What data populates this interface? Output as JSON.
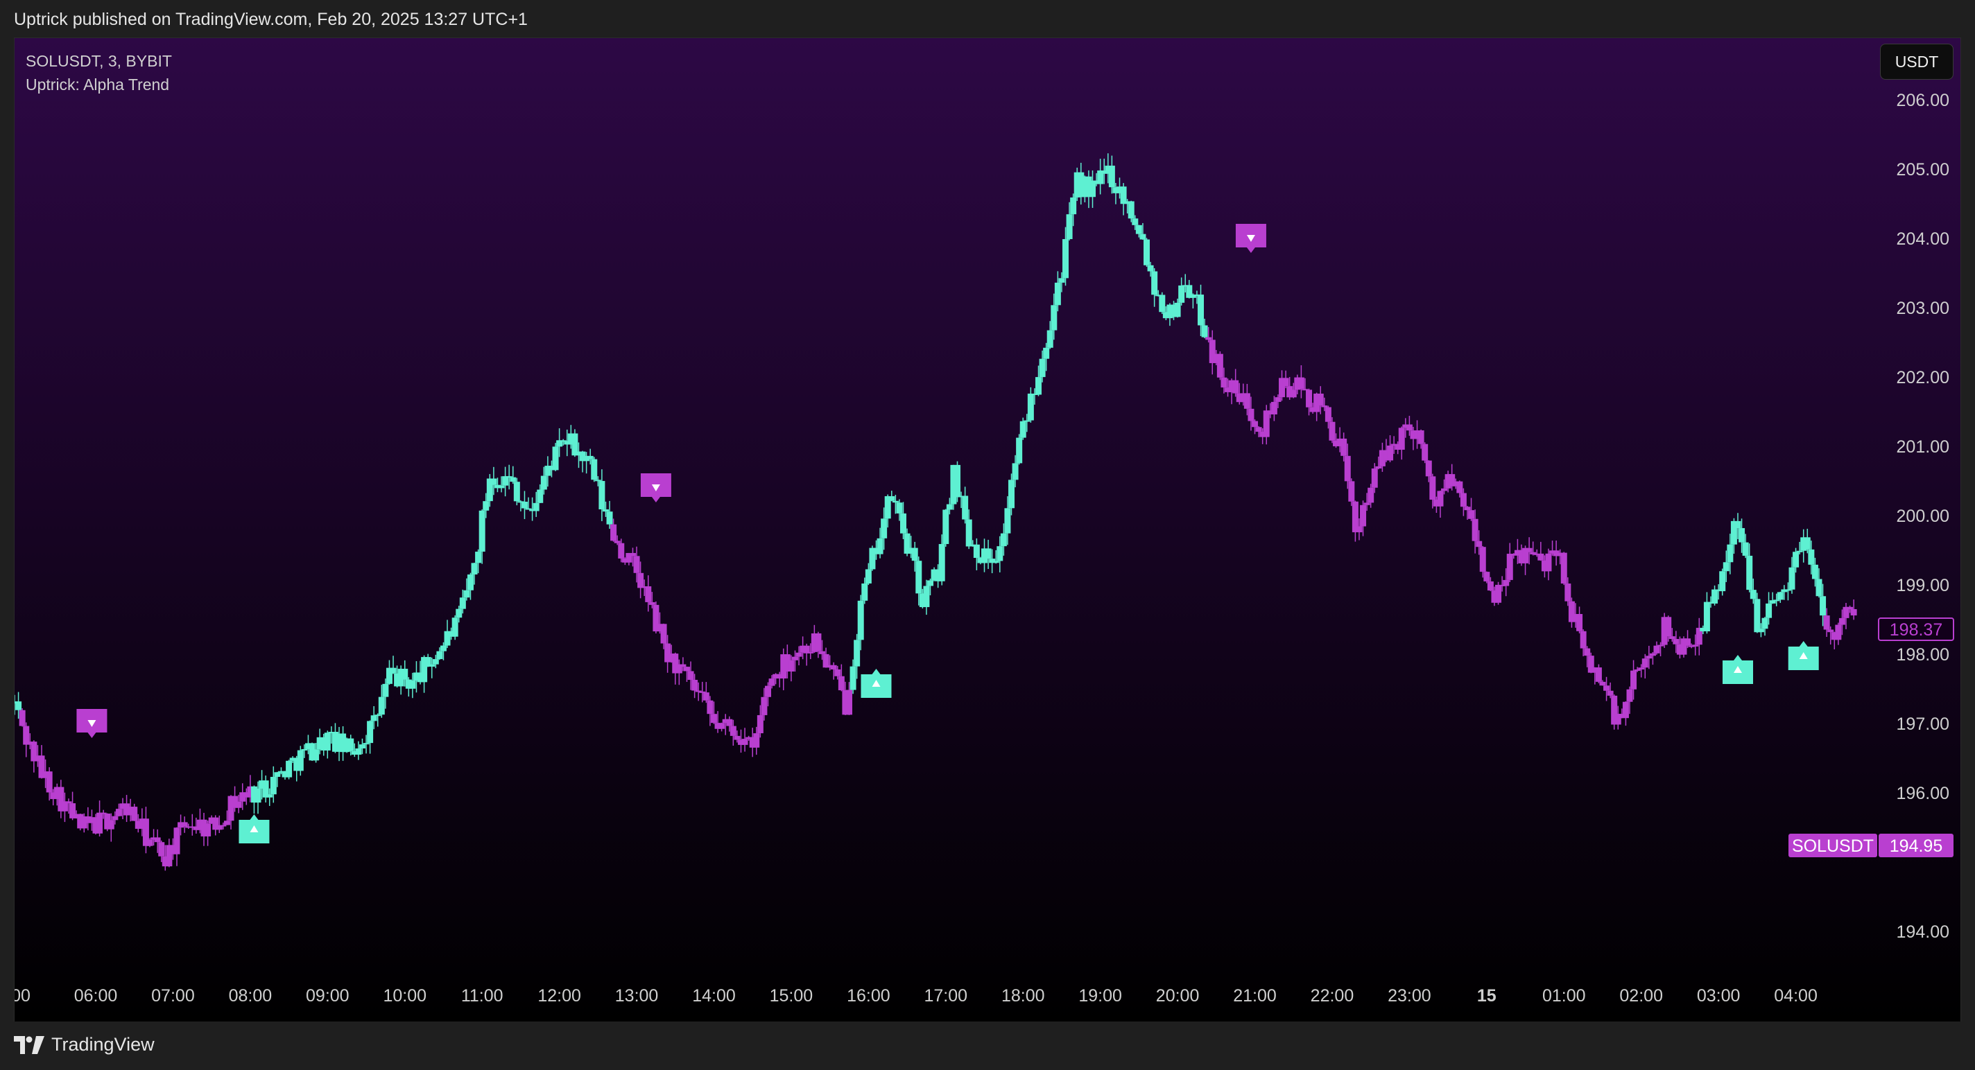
{
  "header": {
    "published_text": "Uptrick published on TradingView.com, Feb 20, 2025 13:27 UTC+1"
  },
  "legend": {
    "symbol_line": "SOLUSDT, 3, BYBIT",
    "indicator_line": "Uptrick: Alpha Trend"
  },
  "toolbar": {
    "currency_label": "USDT"
  },
  "footer": {
    "brand": "TradingView"
  },
  "colors": {
    "bull": "#5ef0d2",
    "bear": "#b93fd0",
    "bg_top": "#2d0845",
    "bg_bottom": "#000000",
    "axis_text": "#cfcfcf"
  },
  "chart_data": {
    "type": "candlestick",
    "symbol": "SOLUSDT",
    "timeframe": "3",
    "exchange": "BYBIT",
    "x_tick_labels": [
      ":00",
      "06:00",
      "07:00",
      "08:00",
      "09:00",
      "10:00",
      "11:00",
      "12:00",
      "13:00",
      "14:00",
      "15:00",
      "16:00",
      "17:00",
      "18:00",
      "19:00",
      "20:00",
      "21:00",
      "22:00",
      "23:00",
      "15",
      "01:00",
      "02:00",
      "03:00",
      "04:00"
    ],
    "x_tick_hours": [
      5,
      6,
      7,
      8,
      9,
      10,
      11,
      12,
      13,
      14,
      15,
      16,
      17,
      18,
      19,
      20,
      21,
      22,
      23,
      24,
      25,
      26,
      27,
      28
    ],
    "bold_tick": "15",
    "x_range_hours": [
      4.95,
      29.0
    ],
    "y_ticks": [
      194.0,
      196.0,
      197.0,
      198.0,
      199.0,
      200.0,
      201.0,
      202.0,
      203.0,
      204.0,
      205.0,
      206.0
    ],
    "y_tick_labels": [
      "194.00",
      "196.00",
      "197.00",
      "198.00",
      "199.00",
      "200.00",
      "201.00",
      "202.00",
      "203.00",
      "204.00",
      "205.00",
      "206.00"
    ],
    "ylim": [
      193.5,
      206.5
    ],
    "price_path": [
      {
        "h": 4.95,
        "p": 197.3,
        "trend": "bull"
      },
      {
        "h": 5.1,
        "p": 196.8,
        "trend": "bear"
      },
      {
        "h": 5.3,
        "p": 196.3,
        "trend": "bear"
      },
      {
        "h": 5.5,
        "p": 196.0,
        "trend": "bear"
      },
      {
        "h": 5.8,
        "p": 195.5,
        "trend": "bear"
      },
      {
        "h": 6.1,
        "p": 195.6,
        "trend": "bear"
      },
      {
        "h": 6.4,
        "p": 195.8,
        "trend": "bear"
      },
      {
        "h": 6.7,
        "p": 195.3,
        "trend": "bear"
      },
      {
        "h": 6.9,
        "p": 195.1,
        "trend": "bear"
      },
      {
        "h": 7.2,
        "p": 195.6,
        "trend": "bear"
      },
      {
        "h": 7.5,
        "p": 195.5,
        "trend": "bear"
      },
      {
        "h": 7.8,
        "p": 195.9,
        "trend": "bear"
      },
      {
        "h": 8.2,
        "p": 196.1,
        "trend": "bull"
      },
      {
        "h": 8.6,
        "p": 196.5,
        "trend": "bull"
      },
      {
        "h": 9.0,
        "p": 196.8,
        "trend": "bull"
      },
      {
        "h": 9.3,
        "p": 196.6,
        "trend": "bull"
      },
      {
        "h": 9.6,
        "p": 197.0,
        "trend": "bull"
      },
      {
        "h": 9.8,
        "p": 197.7,
        "trend": "bull"
      },
      {
        "h": 10.1,
        "p": 197.6,
        "trend": "bull"
      },
      {
        "h": 10.4,
        "p": 198.0,
        "trend": "bull"
      },
      {
        "h": 10.7,
        "p": 198.5,
        "trend": "bull"
      },
      {
        "h": 10.9,
        "p": 199.3,
        "trend": "bull"
      },
      {
        "h": 11.1,
        "p": 200.6,
        "trend": "bull"
      },
      {
        "h": 11.4,
        "p": 200.5,
        "trend": "bull"
      },
      {
        "h": 11.6,
        "p": 200.0,
        "trend": "bull"
      },
      {
        "h": 11.9,
        "p": 200.8,
        "trend": "bull"
      },
      {
        "h": 12.1,
        "p": 201.1,
        "trend": "bull"
      },
      {
        "h": 12.4,
        "p": 200.7,
        "trend": "bull"
      },
      {
        "h": 12.6,
        "p": 200.0,
        "trend": "bull"
      },
      {
        "h": 12.8,
        "p": 199.5,
        "trend": "bear"
      },
      {
        "h": 13.0,
        "p": 199.2,
        "trend": "bear"
      },
      {
        "h": 13.2,
        "p": 198.6,
        "trend": "bear"
      },
      {
        "h": 13.4,
        "p": 198.0,
        "trend": "bear"
      },
      {
        "h": 13.6,
        "p": 197.7,
        "trend": "bear"
      },
      {
        "h": 13.8,
        "p": 197.4,
        "trend": "bear"
      },
      {
        "h": 14.0,
        "p": 197.0,
        "trend": "bear"
      },
      {
        "h": 14.3,
        "p": 196.9,
        "trend": "bear"
      },
      {
        "h": 14.5,
        "p": 196.6,
        "trend": "bear"
      },
      {
        "h": 14.7,
        "p": 197.6,
        "trend": "bear"
      },
      {
        "h": 15.0,
        "p": 198.0,
        "trend": "bear"
      },
      {
        "h": 15.3,
        "p": 198.2,
        "trend": "bear"
      },
      {
        "h": 15.5,
        "p": 197.8,
        "trend": "bear"
      },
      {
        "h": 15.7,
        "p": 197.3,
        "trend": "bear"
      },
      {
        "h": 15.9,
        "p": 198.7,
        "trend": "bull"
      },
      {
        "h": 16.1,
        "p": 199.6,
        "trend": "bull"
      },
      {
        "h": 16.3,
        "p": 200.3,
        "trend": "bull"
      },
      {
        "h": 16.5,
        "p": 199.6,
        "trend": "bull"
      },
      {
        "h": 16.7,
        "p": 198.8,
        "trend": "bull"
      },
      {
        "h": 16.9,
        "p": 199.2,
        "trend": "bull"
      },
      {
        "h": 17.1,
        "p": 200.7,
        "trend": "bull"
      },
      {
        "h": 17.3,
        "p": 199.7,
        "trend": "bull"
      },
      {
        "h": 17.5,
        "p": 199.4,
        "trend": "bull"
      },
      {
        "h": 17.7,
        "p": 199.5,
        "trend": "bull"
      },
      {
        "h": 17.9,
        "p": 200.8,
        "trend": "bull"
      },
      {
        "h": 18.1,
        "p": 201.7,
        "trend": "bull"
      },
      {
        "h": 18.3,
        "p": 202.6,
        "trend": "bull"
      },
      {
        "h": 18.5,
        "p": 203.6,
        "trend": "bull"
      },
      {
        "h": 18.7,
        "p": 204.8,
        "trend": "bull"
      },
      {
        "h": 18.9,
        "p": 204.7,
        "trend": "bull"
      },
      {
        "h": 19.1,
        "p": 205.0,
        "trend": "bull"
      },
      {
        "h": 19.3,
        "p": 204.6,
        "trend": "bull"
      },
      {
        "h": 19.5,
        "p": 204.2,
        "trend": "bull"
      },
      {
        "h": 19.7,
        "p": 203.3,
        "trend": "bull"
      },
      {
        "h": 19.9,
        "p": 202.9,
        "trend": "bull"
      },
      {
        "h": 20.1,
        "p": 203.4,
        "trend": "bull"
      },
      {
        "h": 20.3,
        "p": 202.9,
        "trend": "bull"
      },
      {
        "h": 20.5,
        "p": 202.2,
        "trend": "bear"
      },
      {
        "h": 20.7,
        "p": 201.8,
        "trend": "bear"
      },
      {
        "h": 20.9,
        "p": 201.6,
        "trend": "bear"
      },
      {
        "h": 21.1,
        "p": 201.3,
        "trend": "bear"
      },
      {
        "h": 21.3,
        "p": 201.8,
        "trend": "bear"
      },
      {
        "h": 21.5,
        "p": 201.9,
        "trend": "bear"
      },
      {
        "h": 21.7,
        "p": 201.7,
        "trend": "bear"
      },
      {
        "h": 21.9,
        "p": 201.5,
        "trend": "bear"
      },
      {
        "h": 22.1,
        "p": 201.0,
        "trend": "bear"
      },
      {
        "h": 22.3,
        "p": 199.8,
        "trend": "bear"
      },
      {
        "h": 22.5,
        "p": 200.5,
        "trend": "bear"
      },
      {
        "h": 22.7,
        "p": 200.9,
        "trend": "bear"
      },
      {
        "h": 22.9,
        "p": 201.2,
        "trend": "bear"
      },
      {
        "h": 23.1,
        "p": 201.3,
        "trend": "bear"
      },
      {
        "h": 23.3,
        "p": 200.2,
        "trend": "bear"
      },
      {
        "h": 23.5,
        "p": 200.5,
        "trend": "bear"
      },
      {
        "h": 23.7,
        "p": 200.2,
        "trend": "bear"
      },
      {
        "h": 23.9,
        "p": 199.5,
        "trend": "bear"
      },
      {
        "h": 24.1,
        "p": 198.7,
        "trend": "bear"
      },
      {
        "h": 24.3,
        "p": 199.3,
        "trend": "bear"
      },
      {
        "h": 24.5,
        "p": 199.5,
        "trend": "bear"
      },
      {
        "h": 24.7,
        "p": 199.3,
        "trend": "bear"
      },
      {
        "h": 24.9,
        "p": 199.6,
        "trend": "bear"
      },
      {
        "h": 25.1,
        "p": 198.6,
        "trend": "bear"
      },
      {
        "h": 25.3,
        "p": 197.9,
        "trend": "bear"
      },
      {
        "h": 25.5,
        "p": 197.6,
        "trend": "bear"
      },
      {
        "h": 25.7,
        "p": 197.0,
        "trend": "bear"
      },
      {
        "h": 25.9,
        "p": 197.6,
        "trend": "bear"
      },
      {
        "h": 26.1,
        "p": 198.0,
        "trend": "bear"
      },
      {
        "h": 26.3,
        "p": 198.4,
        "trend": "bear"
      },
      {
        "h": 26.5,
        "p": 198.1,
        "trend": "bear"
      },
      {
        "h": 26.7,
        "p": 198.3,
        "trend": "bear"
      },
      {
        "h": 26.9,
        "p": 198.7,
        "trend": "bull"
      },
      {
        "h": 27.1,
        "p": 199.4,
        "trend": "bull"
      },
      {
        "h": 27.2,
        "p": 199.9,
        "trend": "bull"
      },
      {
        "h": 27.35,
        "p": 199.4,
        "trend": "bull"
      },
      {
        "h": 27.5,
        "p": 198.5,
        "trend": "bull"
      },
      {
        "h": 27.7,
        "p": 198.7,
        "trend": "bull"
      },
      {
        "h": 27.9,
        "p": 199.1,
        "trend": "bull"
      },
      {
        "h": 28.1,
        "p": 199.7,
        "trend": "bull"
      },
      {
        "h": 28.3,
        "p": 199.0,
        "trend": "bull"
      },
      {
        "h": 28.45,
        "p": 198.2,
        "trend": "bear"
      },
      {
        "h": 28.6,
        "p": 198.7,
        "trend": "bear"
      },
      {
        "h": 28.8,
        "p": 198.4,
        "trend": "bear"
      }
    ],
    "signals": [
      {
        "type": "sell",
        "h": 5.95,
        "p": 197.0
      },
      {
        "type": "buy",
        "h": 8.05,
        "p": 195.5
      },
      {
        "type": "sell",
        "h": 13.25,
        "p": 200.4
      },
      {
        "type": "buy",
        "h": 16.1,
        "p": 197.6
      },
      {
        "type": "sell",
        "h": 20.95,
        "p": 204.0
      },
      {
        "type": "buy",
        "h": 27.25,
        "p": 197.8
      },
      {
        "type": "buy",
        "h": 28.1,
        "p": 198.0
      }
    ],
    "price_labels": [
      {
        "name": "last-price",
        "value": "198.37",
        "price": 198.37,
        "style": "outline"
      },
      {
        "name": "symbol-price",
        "symbol": "SOLUSDT",
        "value": "194.95",
        "price": 195.25,
        "style": "filled"
      }
    ]
  }
}
